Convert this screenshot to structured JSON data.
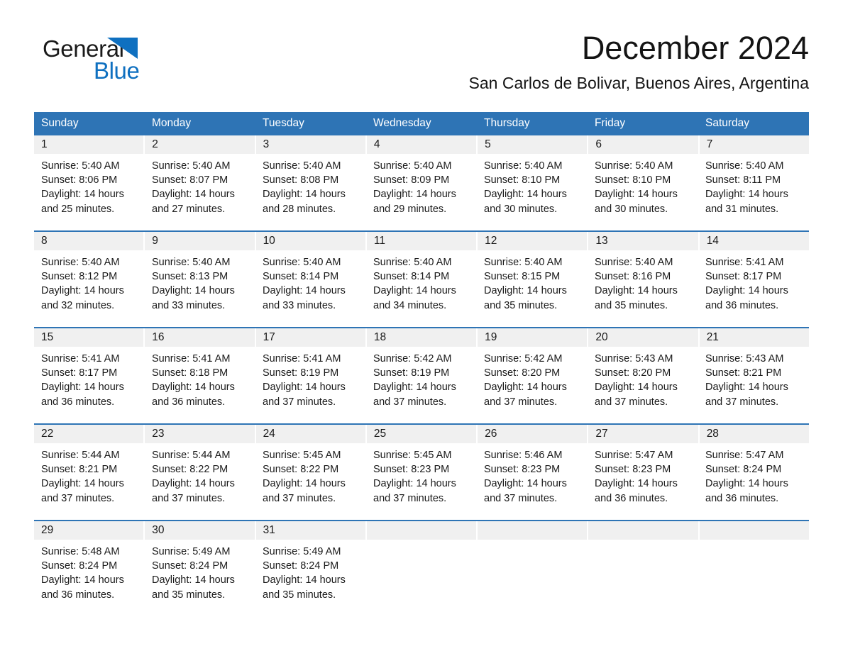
{
  "brand": {
    "name_part1": "General",
    "name_part2": "Blue"
  },
  "header": {
    "title": "December 2024",
    "location": "San Carlos de Bolivar, Buenos Aires, Argentina"
  },
  "colors": {
    "header_blue": "#2e74b5",
    "logo_blue": "#0f70c0",
    "daynum_band": "#f0f0f0",
    "text": "#1a1a1a"
  },
  "weekdays": [
    "Sunday",
    "Monday",
    "Tuesday",
    "Wednesday",
    "Thursday",
    "Friday",
    "Saturday"
  ],
  "weeks": [
    {
      "days": [
        {
          "num": "1",
          "sunrise": "Sunrise: 5:40 AM",
          "sunset": "Sunset: 8:06 PM",
          "daylight1": "Daylight: 14 hours",
          "daylight2": "and 25 minutes."
        },
        {
          "num": "2",
          "sunrise": "Sunrise: 5:40 AM",
          "sunset": "Sunset: 8:07 PM",
          "daylight1": "Daylight: 14 hours",
          "daylight2": "and 27 minutes."
        },
        {
          "num": "3",
          "sunrise": "Sunrise: 5:40 AM",
          "sunset": "Sunset: 8:08 PM",
          "daylight1": "Daylight: 14 hours",
          "daylight2": "and 28 minutes."
        },
        {
          "num": "4",
          "sunrise": "Sunrise: 5:40 AM",
          "sunset": "Sunset: 8:09 PM",
          "daylight1": "Daylight: 14 hours",
          "daylight2": "and 29 minutes."
        },
        {
          "num": "5",
          "sunrise": "Sunrise: 5:40 AM",
          "sunset": "Sunset: 8:10 PM",
          "daylight1": "Daylight: 14 hours",
          "daylight2": "and 30 minutes."
        },
        {
          "num": "6",
          "sunrise": "Sunrise: 5:40 AM",
          "sunset": "Sunset: 8:10 PM",
          "daylight1": "Daylight: 14 hours",
          "daylight2": "and 30 minutes."
        },
        {
          "num": "7",
          "sunrise": "Sunrise: 5:40 AM",
          "sunset": "Sunset: 8:11 PM",
          "daylight1": "Daylight: 14 hours",
          "daylight2": "and 31 minutes."
        }
      ]
    },
    {
      "days": [
        {
          "num": "8",
          "sunrise": "Sunrise: 5:40 AM",
          "sunset": "Sunset: 8:12 PM",
          "daylight1": "Daylight: 14 hours",
          "daylight2": "and 32 minutes."
        },
        {
          "num": "9",
          "sunrise": "Sunrise: 5:40 AM",
          "sunset": "Sunset: 8:13 PM",
          "daylight1": "Daylight: 14 hours",
          "daylight2": "and 33 minutes."
        },
        {
          "num": "10",
          "sunrise": "Sunrise: 5:40 AM",
          "sunset": "Sunset: 8:14 PM",
          "daylight1": "Daylight: 14 hours",
          "daylight2": "and 33 minutes."
        },
        {
          "num": "11",
          "sunrise": "Sunrise: 5:40 AM",
          "sunset": "Sunset: 8:14 PM",
          "daylight1": "Daylight: 14 hours",
          "daylight2": "and 34 minutes."
        },
        {
          "num": "12",
          "sunrise": "Sunrise: 5:40 AM",
          "sunset": "Sunset: 8:15 PM",
          "daylight1": "Daylight: 14 hours",
          "daylight2": "and 35 minutes."
        },
        {
          "num": "13",
          "sunrise": "Sunrise: 5:40 AM",
          "sunset": "Sunset: 8:16 PM",
          "daylight1": "Daylight: 14 hours",
          "daylight2": "and 35 minutes."
        },
        {
          "num": "14",
          "sunrise": "Sunrise: 5:41 AM",
          "sunset": "Sunset: 8:17 PM",
          "daylight1": "Daylight: 14 hours",
          "daylight2": "and 36 minutes."
        }
      ]
    },
    {
      "days": [
        {
          "num": "15",
          "sunrise": "Sunrise: 5:41 AM",
          "sunset": "Sunset: 8:17 PM",
          "daylight1": "Daylight: 14 hours",
          "daylight2": "and 36 minutes."
        },
        {
          "num": "16",
          "sunrise": "Sunrise: 5:41 AM",
          "sunset": "Sunset: 8:18 PM",
          "daylight1": "Daylight: 14 hours",
          "daylight2": "and 36 minutes."
        },
        {
          "num": "17",
          "sunrise": "Sunrise: 5:41 AM",
          "sunset": "Sunset: 8:19 PM",
          "daylight1": "Daylight: 14 hours",
          "daylight2": "and 37 minutes."
        },
        {
          "num": "18",
          "sunrise": "Sunrise: 5:42 AM",
          "sunset": "Sunset: 8:19 PM",
          "daylight1": "Daylight: 14 hours",
          "daylight2": "and 37 minutes."
        },
        {
          "num": "19",
          "sunrise": "Sunrise: 5:42 AM",
          "sunset": "Sunset: 8:20 PM",
          "daylight1": "Daylight: 14 hours",
          "daylight2": "and 37 minutes."
        },
        {
          "num": "20",
          "sunrise": "Sunrise: 5:43 AM",
          "sunset": "Sunset: 8:20 PM",
          "daylight1": "Daylight: 14 hours",
          "daylight2": "and 37 minutes."
        },
        {
          "num": "21",
          "sunrise": "Sunrise: 5:43 AM",
          "sunset": "Sunset: 8:21 PM",
          "daylight1": "Daylight: 14 hours",
          "daylight2": "and 37 minutes."
        }
      ]
    },
    {
      "days": [
        {
          "num": "22",
          "sunrise": "Sunrise: 5:44 AM",
          "sunset": "Sunset: 8:21 PM",
          "daylight1": "Daylight: 14 hours",
          "daylight2": "and 37 minutes."
        },
        {
          "num": "23",
          "sunrise": "Sunrise: 5:44 AM",
          "sunset": "Sunset: 8:22 PM",
          "daylight1": "Daylight: 14 hours",
          "daylight2": "and 37 minutes."
        },
        {
          "num": "24",
          "sunrise": "Sunrise: 5:45 AM",
          "sunset": "Sunset: 8:22 PM",
          "daylight1": "Daylight: 14 hours",
          "daylight2": "and 37 minutes."
        },
        {
          "num": "25",
          "sunrise": "Sunrise: 5:45 AM",
          "sunset": "Sunset: 8:23 PM",
          "daylight1": "Daylight: 14 hours",
          "daylight2": "and 37 minutes."
        },
        {
          "num": "26",
          "sunrise": "Sunrise: 5:46 AM",
          "sunset": "Sunset: 8:23 PM",
          "daylight1": "Daylight: 14 hours",
          "daylight2": "and 37 minutes."
        },
        {
          "num": "27",
          "sunrise": "Sunrise: 5:47 AM",
          "sunset": "Sunset: 8:23 PM",
          "daylight1": "Daylight: 14 hours",
          "daylight2": "and 36 minutes."
        },
        {
          "num": "28",
          "sunrise": "Sunrise: 5:47 AM",
          "sunset": "Sunset: 8:24 PM",
          "daylight1": "Daylight: 14 hours",
          "daylight2": "and 36 minutes."
        }
      ]
    },
    {
      "days": [
        {
          "num": "29",
          "sunrise": "Sunrise: 5:48 AM",
          "sunset": "Sunset: 8:24 PM",
          "daylight1": "Daylight: 14 hours",
          "daylight2": "and 36 minutes."
        },
        {
          "num": "30",
          "sunrise": "Sunrise: 5:49 AM",
          "sunset": "Sunset: 8:24 PM",
          "daylight1": "Daylight: 14 hours",
          "daylight2": "and 35 minutes."
        },
        {
          "num": "31",
          "sunrise": "Sunrise: 5:49 AM",
          "sunset": "Sunset: 8:24 PM",
          "daylight1": "Daylight: 14 hours",
          "daylight2": "and 35 minutes."
        },
        {
          "num": "",
          "sunrise": "",
          "sunset": "",
          "daylight1": "",
          "daylight2": ""
        },
        {
          "num": "",
          "sunrise": "",
          "sunset": "",
          "daylight1": "",
          "daylight2": ""
        },
        {
          "num": "",
          "sunrise": "",
          "sunset": "",
          "daylight1": "",
          "daylight2": ""
        },
        {
          "num": "",
          "sunrise": "",
          "sunset": "",
          "daylight1": "",
          "daylight2": ""
        }
      ]
    }
  ]
}
